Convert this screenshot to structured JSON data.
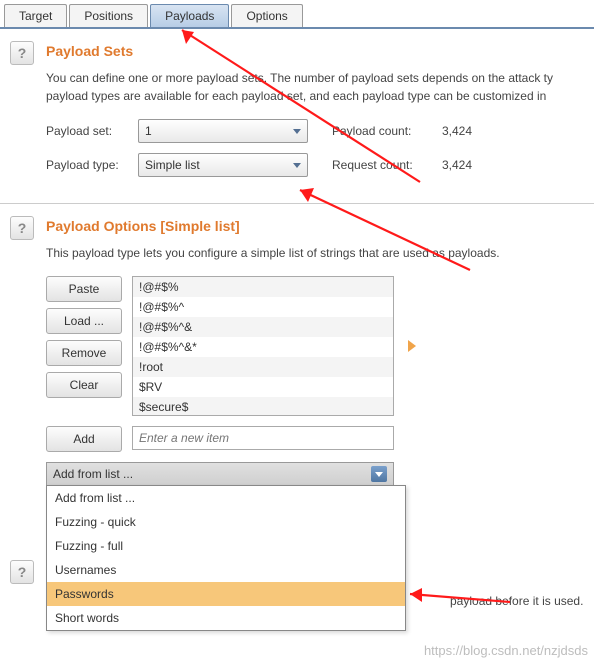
{
  "tabs": {
    "items": [
      "Target",
      "Positions",
      "Payloads",
      "Options"
    ],
    "active_index": 2
  },
  "payload_sets": {
    "heading": "Payload Sets",
    "description": "You can define one or more payload sets. The number of payload sets depends on the attack ty\npayload types are available for each payload set, and each payload type can be customized in ",
    "set_label": "Payload set:",
    "set_value": "1",
    "type_label": "Payload type:",
    "type_value": "Simple list",
    "payload_count_label": "Payload count:",
    "payload_count_value": "3,424",
    "request_count_label": "Request count:",
    "request_count_value": "3,424"
  },
  "payload_options": {
    "heading": "Payload Options [Simple list]",
    "description": "This payload type lets you configure a simple list of strings that are used as payloads.",
    "buttons": {
      "paste": "Paste",
      "load": "Load ...",
      "remove": "Remove",
      "clear": "Clear",
      "add": "Add"
    },
    "list_items": [
      "!@#$%",
      "!@#$%^",
      "!@#$%^&",
      "!@#$%^&*",
      "!root",
      "$RV",
      "$secure$"
    ],
    "add_placeholder": "Enter a new item",
    "addfrom_label": "Add from list ...",
    "addfrom_options": [
      "Add from list ...",
      "Fuzzing - quick",
      "Fuzzing - full",
      "Usernames",
      "Passwords",
      "Short words"
    ],
    "addfrom_hover_index": 4
  },
  "processing": {
    "trail_text": "payload before it is used."
  },
  "help_icon": "?",
  "watermark": "https://blog.csdn.net/nzjdsds"
}
